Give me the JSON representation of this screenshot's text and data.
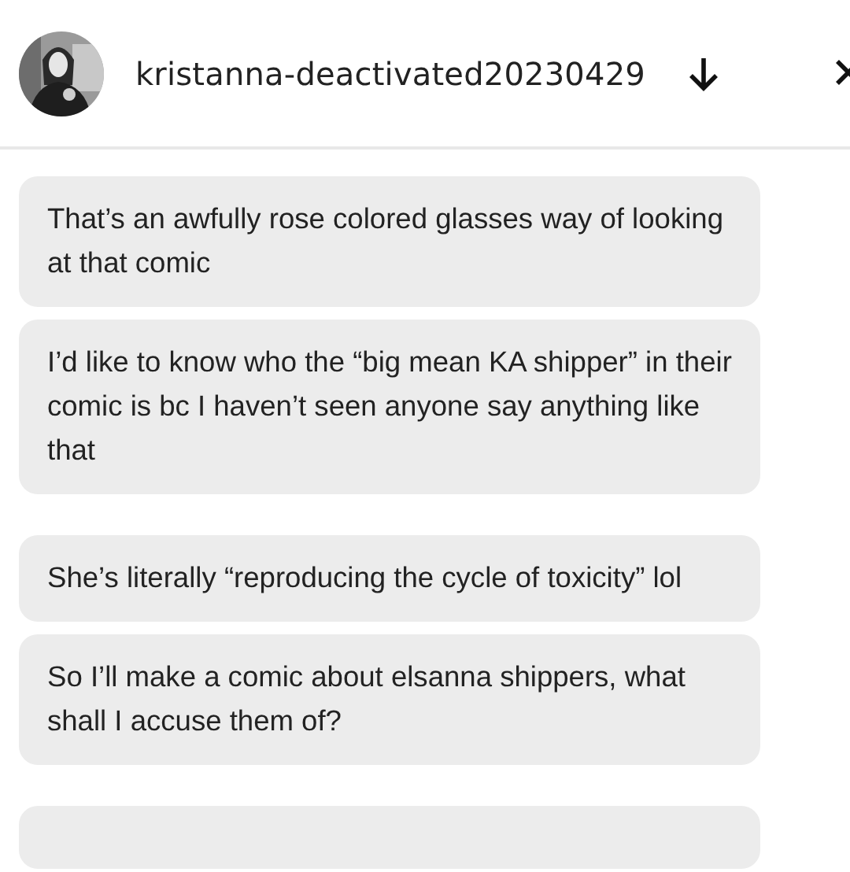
{
  "header": {
    "username": "kristanna-deactivated20230429"
  },
  "groups": [
    {
      "messages": [
        "That’s an awfully rose colored glasses way of looking at that comic",
        "I’d like to know who the “big mean KA shipper” in their comic is bc I haven’t seen anyone say anything like that"
      ]
    },
    {
      "messages": [
        "She’s literally “reproducing the cycle of toxicity” lol",
        "So I’ll make a comic about elsanna shippers, what shall I accuse them of?"
      ]
    }
  ],
  "more_below": true
}
